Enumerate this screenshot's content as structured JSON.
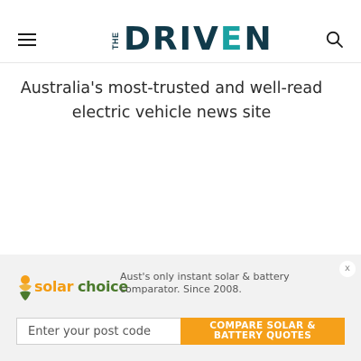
{
  "header": {
    "logo": {
      "prefix": "THE",
      "word_part1": "DRIV",
      "word_accent": "E",
      "word_part2": "N"
    },
    "menu_icon": "hamburger-icon",
    "search_icon": "search-icon",
    "colors": {
      "logo_dark": "#113a4a",
      "logo_accent": "#1aa2a2"
    }
  },
  "tagline": {
    "line1": "Australia's most-trusted and well-read",
    "line2": "electric vehicle news site"
  },
  "ad": {
    "close_label": "x",
    "brand": {
      "solar": "solar",
      "choice": "choice"
    },
    "description": "Aust's only instant solar & battery comparator. Since 2008.",
    "postcode_placeholder": "Enter your post code",
    "cta_label": "COMPARE SOLAR & BATTERY QUOTES",
    "colors": {
      "cta": "#f5a01a",
      "brand_green": "#4a7a2c"
    }
  }
}
